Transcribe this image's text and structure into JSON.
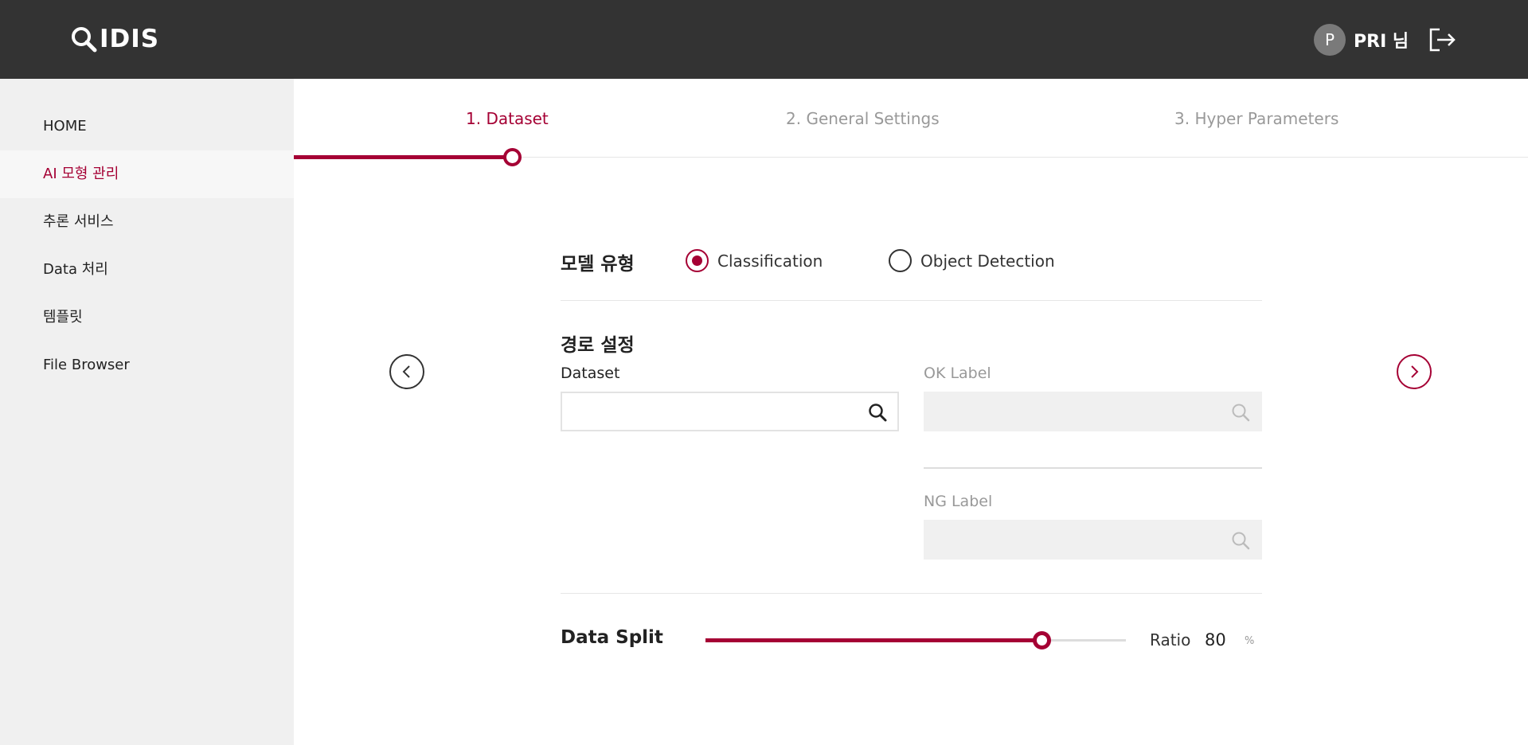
{
  "header": {
    "logo_text": "IDIS",
    "user": {
      "initial": "P",
      "name": "PRI 님"
    },
    "logout_icon": "logout-icon"
  },
  "sidebar": {
    "items": [
      {
        "label": "HOME",
        "active": false
      },
      {
        "label": "AI 모형 관리",
        "active": true
      },
      {
        "label": "추론 서비스",
        "active": false
      },
      {
        "label": "Data 처리",
        "active": false
      },
      {
        "label": "템플릿",
        "active": false
      },
      {
        "label": "File Browser",
        "active": false
      }
    ]
  },
  "stepper": {
    "steps": [
      {
        "label": "1. Dataset",
        "active": true
      },
      {
        "label": "2. General Settings",
        "active": false
      },
      {
        "label": "3. Hyper Parameters",
        "active": false
      }
    ]
  },
  "form": {
    "model_type": {
      "title": "모델 유형",
      "options": [
        {
          "label": "Classification",
          "checked": true
        },
        {
          "label": "Object Detection",
          "checked": false
        }
      ]
    },
    "path": {
      "title": "경로 설정",
      "dataset": {
        "label": "Dataset",
        "value": ""
      },
      "ok_label": {
        "label": "OK Label",
        "value": ""
      },
      "ng_label": {
        "label": "NG Label",
        "value": ""
      }
    },
    "data_split": {
      "title": "Data Split",
      "ratio_label": "Ratio",
      "ratio_value": "80",
      "ratio_unit": "%",
      "slider_fraction": 0.8
    }
  },
  "colors": {
    "accent": "#a50034",
    "header_bg": "#333333",
    "sidebar_bg": "#f0f0f0"
  }
}
